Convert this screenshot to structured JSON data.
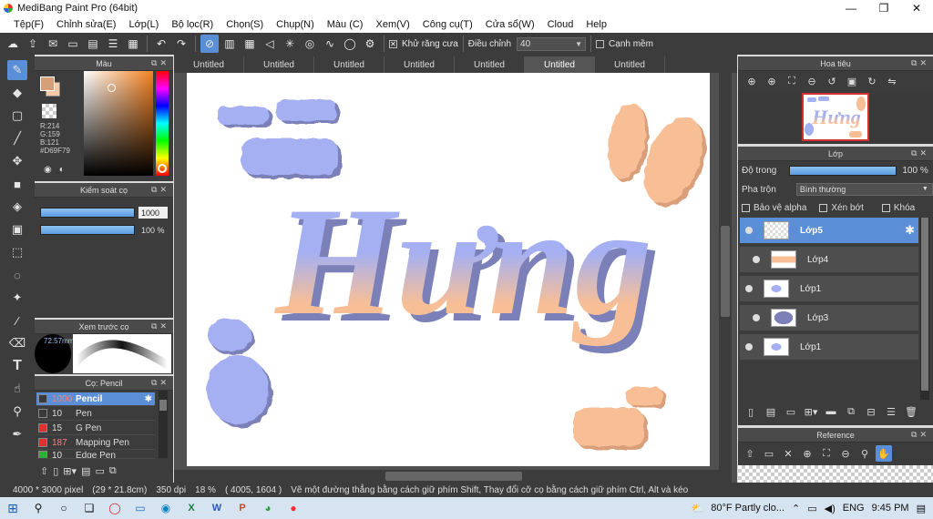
{
  "window": {
    "title": "MediBang Paint Pro (64bit)",
    "min": "—",
    "max": "❐",
    "close": "✕"
  },
  "menu": [
    "Tệp(F)",
    "Chỉnh sửa(E)",
    "Lớp(L)",
    "Bộ lọc(R)",
    "Chọn(S)",
    "Chụp(N)",
    "Màu (C)",
    "Xem(V)",
    "Công cụ(T)",
    "Cửa sổ(W)",
    "Cloud",
    "Help"
  ],
  "toolbar": {
    "antialias_label": "Khử răng cưa",
    "correction_label": "Điều chỉnh",
    "correction_value": "40",
    "soft_edge_label": "Cạnh mềm"
  },
  "color_panel": {
    "title": "Màu",
    "r": "R:214",
    "g": "G:159",
    "b": "B:121",
    "hex": "#D69F79",
    "fg_color": "#D69F79"
  },
  "brush_control": {
    "title": "Kiểm soát cọ",
    "size": "1000",
    "opacity": "100 %",
    "size_fraction": 1.0,
    "opacity_fraction": 1.0
  },
  "brush_preview": {
    "title": "Xem trước cọ",
    "size_readout": "72.57mm"
  },
  "brush_list": {
    "title": "Cọ: Pencil",
    "items": [
      {
        "size": "1000",
        "name": "Pencil",
        "color": "#3a3a3a",
        "active": true
      },
      {
        "size": "10",
        "name": "Pen",
        "color": "#3a3a3a"
      },
      {
        "size": "15",
        "name": "G Pen",
        "color": "#e03030"
      },
      {
        "size": "187",
        "name": "Mapping Pen",
        "color": "#e03030"
      },
      {
        "size": "10",
        "name": "Edge Pen",
        "color": "#30b030"
      }
    ]
  },
  "doc_tabs": [
    "Untitled",
    "Untitled",
    "Untitled",
    "Untitled",
    "Untitled",
    "Untitled",
    "Untitled"
  ],
  "active_tab": 5,
  "canvas": {
    "art_text": "Hưng",
    "blue": "#a4b0f2",
    "peach": "#f8bf96"
  },
  "navigator": {
    "title": "Hoa tiêu",
    "thumb_text": "Hưng"
  },
  "layer_panel": {
    "title": "Lớp",
    "opacity_label": "Độ trong",
    "opacity_value": "100 %",
    "opacity_fraction": 1.0,
    "blend_label": "Pha trộn",
    "blend_value": "Bình thường",
    "protect_alpha": "Bảo vệ alpha",
    "clipping": "Xén bớt",
    "lock": "Khóa",
    "layers": [
      {
        "name": "Lớp5",
        "active": true
      },
      {
        "name": "Lớp4"
      },
      {
        "name": "Lớp1"
      },
      {
        "name": "Lớp3"
      },
      {
        "name": "Lớp1"
      }
    ]
  },
  "reference": {
    "title": "Reference"
  },
  "status": {
    "size": "4000 * 3000 pixel",
    "cm": "(29 * 21.8cm)",
    "dpi": "350 dpi",
    "zoom": "18 %",
    "coords": "( 4005, 1604 )",
    "hint": "Vẽ một đường thẳng bằng cách giữ phím Shift, Thay đổi cỡ cọ bằng cách giữ phím Ctrl, Alt và kéo"
  },
  "taskbar": {
    "weather": "80°F  Partly clo...",
    "lang": "ENG",
    "time": "9:45 PM"
  }
}
